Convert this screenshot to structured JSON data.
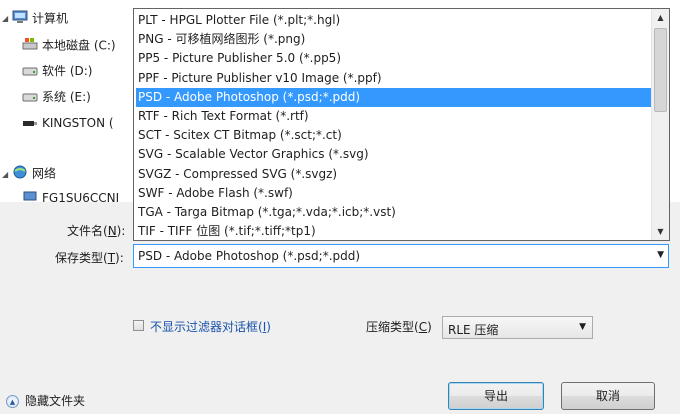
{
  "nav": {
    "items": [
      {
        "label": "计算机",
        "icon": "computer-icon"
      },
      {
        "label": "本地磁盘 (C:)",
        "icon": "drive-c-icon"
      },
      {
        "label": "软件 (D:)",
        "icon": "drive-icon"
      },
      {
        "label": "系统 (E:)",
        "icon": "drive-icon"
      },
      {
        "label": "KINGSTON (",
        "icon": "usb-drive-icon"
      },
      {
        "label": "网络",
        "icon": "network-icon"
      },
      {
        "label": "FG1SU6CCNI",
        "icon": "network-computer-icon"
      }
    ]
  },
  "file_types": {
    "options": [
      "PLT - HPGL Plotter File (*.plt;*.hgl)",
      "PNG - 可移植网络图形 (*.png)",
      "PP5 - Picture Publisher 5.0 (*.pp5)",
      "PPF - Picture Publisher v10 Image (*.ppf)",
      "PSD - Adobe Photoshop (*.psd;*.pdd)",
      "RTF - Rich Text Format (*.rtf)",
      "SCT - Scitex CT Bitmap (*.sct;*.ct)",
      "SVG - Scalable Vector Graphics  (*.svg)",
      "SVGZ - Compressed SVG  (*.svgz)",
      "SWF - Adobe Flash (*.swf)",
      "TGA - Targa Bitmap (*.tga;*.vda;*.icb;*.vst)",
      "TIF - TIFF 位图 (*.tif;*.tiff;*tp1)"
    ],
    "selected_index": 4
  },
  "filename_label": {
    "text": "文件名(",
    "key": "N",
    "suffix": "):"
  },
  "savetype_label": {
    "text": "保存类型(",
    "key": "T",
    "suffix": "):"
  },
  "savetype_value": "PSD - Adobe Photoshop (*.psd;*.pdd)",
  "hide_filter": {
    "text": "不显示过滤器对话框(",
    "key": "I",
    "suffix": ")",
    "checked": false
  },
  "compression": {
    "label_text": "压缩类型(",
    "label_key": "C",
    "label_suffix": ")",
    "value": "RLE 压缩"
  },
  "hide_folders": "隐藏文件夹",
  "buttons": {
    "export": "导出",
    "cancel": "取消"
  },
  "colors": {
    "selection": "#3399ff",
    "link": "#1a53a8",
    "panel": "#f0f0f0"
  }
}
